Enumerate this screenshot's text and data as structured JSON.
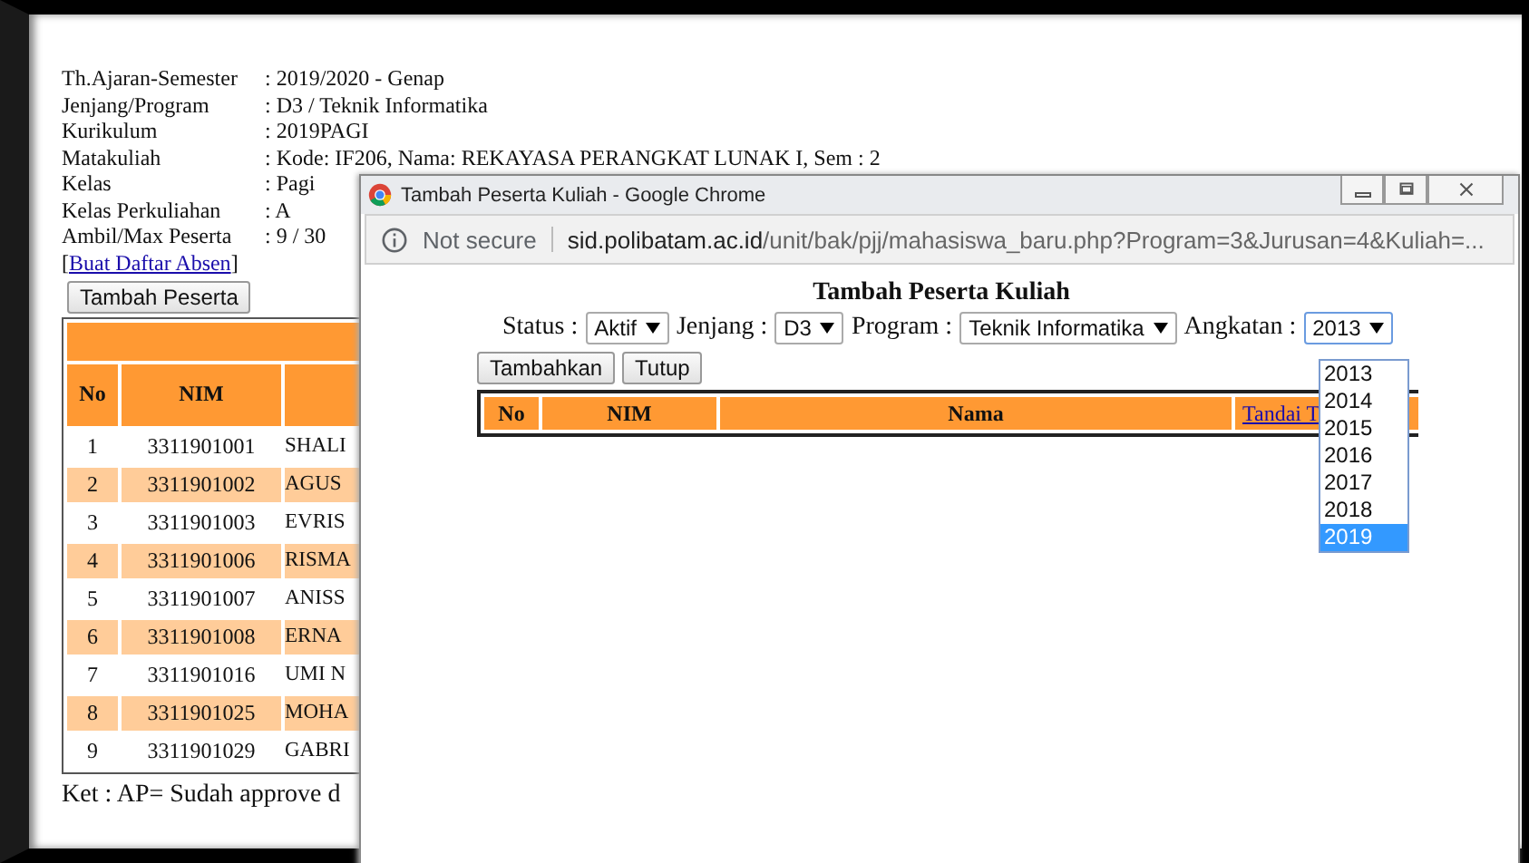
{
  "info": [
    {
      "label": "Th.Ajaran-Semester",
      "value": ": 2019/2020 - Genap"
    },
    {
      "label": "Jenjang/Program",
      "value": ": D3 / Teknik Informatika"
    },
    {
      "label": "Kurikulum",
      "value": ": 2019PAGI"
    },
    {
      "label": "Matakuliah",
      "value": ": Kode: IF206, Nama: REKAYASA PERANGKAT LUNAK I, Sem : 2"
    },
    {
      "label": "Kelas",
      "value": ": Pagi"
    },
    {
      "label": "Kelas Perkuliahan",
      "value": ": A"
    },
    {
      "label": "Ambil/Max Peserta",
      "value": ": 9 / 30"
    }
  ],
  "absen_link": {
    "open": "[",
    "text": "Buat Daftar Absen",
    "close": "]"
  },
  "add_button": "Tambah Peserta",
  "main_table": {
    "columns": [
      "No",
      "NIM"
    ],
    "rows": [
      {
        "no": "1",
        "nim": "3311901001",
        "nama": "SHALI"
      },
      {
        "no": "2",
        "nim": "3311901002",
        "nama": "AGUS"
      },
      {
        "no": "3",
        "nim": "3311901003",
        "nama": "EVRIS"
      },
      {
        "no": "4",
        "nim": "3311901006",
        "nama": "RISMA"
      },
      {
        "no": "5",
        "nim": "3311901007",
        "nama": "ANISS"
      },
      {
        "no": "6",
        "nim": "3311901008",
        "nama": "ERNA"
      },
      {
        "no": "7",
        "nim": "3311901016",
        "nama": "UMI N"
      },
      {
        "no": "8",
        "nim": "3311901025",
        "nama": "MOHA"
      },
      {
        "no": "9",
        "nim": "3311901029",
        "nama": "GABRI"
      }
    ]
  },
  "footnote": "Ket : AP= Sudah approve d",
  "popup": {
    "title": "Tambah Peserta Kuliah - Google Chrome",
    "security": "Not secure",
    "url_host": "sid.polibatam.ac.id",
    "url_path": "/unit/bak/pjj/mahasiswa_baru.php?Program=3&Jurusan=4&Kuliah=...",
    "heading": "Tambah Peserta Kuliah",
    "filters": [
      {
        "label": "Status :",
        "value": "Aktif"
      },
      {
        "label": "Jenjang :",
        "value": "D3"
      },
      {
        "label": "Program :",
        "value": "Teknik Informatika"
      },
      {
        "label": "Angkatan :",
        "value": "2013"
      }
    ],
    "buttons": [
      "Tambahkan",
      "Tutup"
    ],
    "table": {
      "columns": [
        "No",
        "NIM",
        "Nama"
      ],
      "link": "Tandai T"
    },
    "dropdown": [
      {
        "label": "2013",
        "selected": false
      },
      {
        "label": "2014",
        "selected": false
      },
      {
        "label": "2015",
        "selected": false
      },
      {
        "label": "2016",
        "selected": false
      },
      {
        "label": "2017",
        "selected": false
      },
      {
        "label": "2018",
        "selected": false
      },
      {
        "label": "2019",
        "selected": true
      }
    ]
  }
}
